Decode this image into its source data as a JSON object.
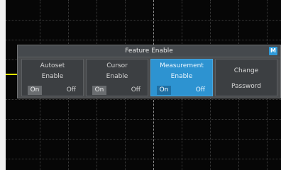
{
  "dialog": {
    "title": "Feature Enable",
    "badge": "M"
  },
  "options": [
    {
      "line1": "Autoset",
      "line2": "Enable",
      "on": "On",
      "off": "Off",
      "active": false
    },
    {
      "line1": "Cursor",
      "line2": "Enable",
      "on": "On",
      "off": "Off",
      "active": false
    },
    {
      "line1": "Measurement",
      "line2": "Enable",
      "on": "On",
      "off": "Off",
      "active": true
    },
    {
      "line1": "Change",
      "line2": "Password"
    }
  ],
  "colors": {
    "accent": "#2d93d1",
    "trace": "#e4e800",
    "screen": "#060606"
  }
}
